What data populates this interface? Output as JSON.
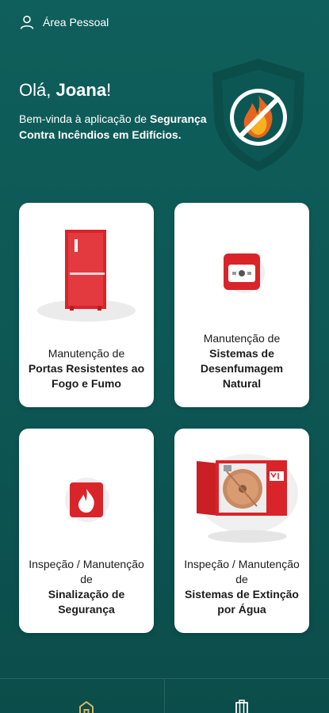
{
  "header": {
    "personal_area_label": "Área Pessoal"
  },
  "greeting": {
    "prefix": "Olá, ",
    "name": "Joana",
    "suffix": "!"
  },
  "intro": {
    "text_before": "Bem-vinda à aplicação de ",
    "app_name": "Segurança Contra Incêndios em Edifícios."
  },
  "cards": [
    {
      "sub": "Manutenção de",
      "main": "Portas Resistentes ao Fogo e Fumo"
    },
    {
      "sub": "Manutenção de",
      "main": "Sistemas de Desenfumagem Natural"
    },
    {
      "sub": "Inspeção / Manutenção de",
      "main": "Sinalização de Segurança"
    },
    {
      "sub": "Inspeção / Manutenção de",
      "main": "Sistemas de Extinção por Água"
    }
  ],
  "nav": {
    "home_icon": "home-icon",
    "buildings_icon": "building-icon"
  },
  "colors": {
    "background": "#0f5f5c",
    "accent_red": "#d9242a",
    "nav_gold": "#d8b56a"
  }
}
